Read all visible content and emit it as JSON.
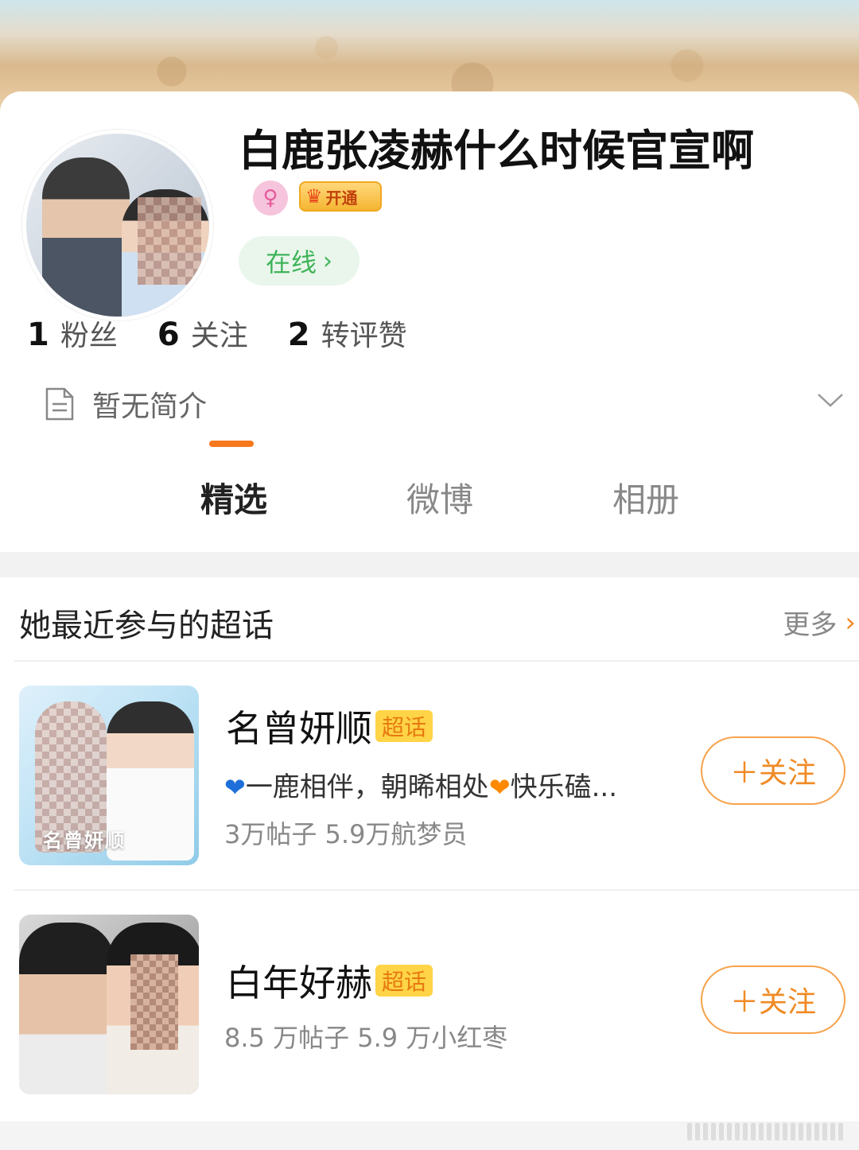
{
  "profile": {
    "nickname": "白鹿张凌赫什么时候官宣啊",
    "vip_label": "开通",
    "online_label": "在线",
    "stats": [
      {
        "num": "1",
        "label": "粉丝"
      },
      {
        "num": "6",
        "label": "关注"
      },
      {
        "num": "2",
        "label": "转评赞"
      }
    ],
    "bio": "暂无简介"
  },
  "tabs": [
    {
      "label": "精选",
      "active": true
    },
    {
      "label": "微博",
      "active": false
    },
    {
      "label": "相册",
      "active": false
    }
  ],
  "supertopics": {
    "title": "她最近参与的超话",
    "more_label": "更多",
    "items": [
      {
        "name": "名曾妍顺",
        "tag": "超话",
        "thumb_caption": "名曾妍顺",
        "desc_part1": "一鹿相伴，朝晞相处",
        "desc_part2": "快乐磕...",
        "meta": "3万帖子 5.9万航梦员",
        "follow_label": "＋关注"
      },
      {
        "name": "白年好赫",
        "tag": "超话",
        "meta": "8.5 万帖子 5.9 万小红枣",
        "follow_label": "＋关注"
      }
    ]
  },
  "colors": {
    "accent": "#f7781d",
    "online_green": "#3fb45a",
    "follow_orange": "#f08a24",
    "super_tag_bg": "#ffd447"
  }
}
